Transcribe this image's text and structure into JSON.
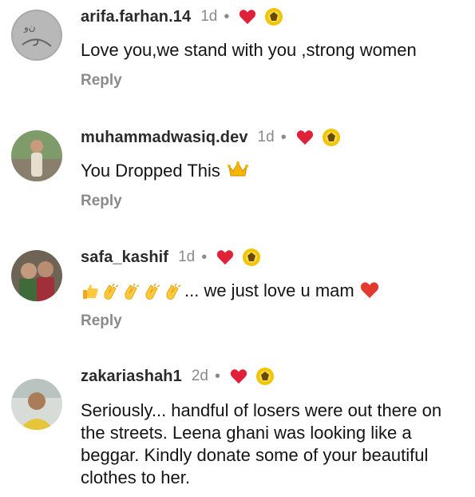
{
  "comments": [
    {
      "username": "arifa.farhan.14",
      "time": "1d",
      "dot": "•",
      "text": "Love you,we stand with you ,strong women",
      "reply": "Reply",
      "avatar_bg": "#9a9a9a"
    },
    {
      "username": "muhammadwasiq.dev",
      "time": "1d",
      "dot": "•",
      "text": "You Dropped This",
      "reply": "Reply",
      "avatar_bg": "#6f8a5c"
    },
    {
      "username": "safa_kashif",
      "time": "1d",
      "dot": "•",
      "text": "... we just love u mam",
      "reply": "Reply",
      "avatar_bg": "#7a6f60"
    },
    {
      "username": "zakariashah1",
      "time": "2d",
      "dot": "•",
      "text": "Seriously... handful of losers were out there on the streets. Leena ghani was looking like a beggar. Kindly donate some of your beautiful clothes to her.",
      "avatar_bg": "#cfd6d0"
    }
  ],
  "icons": {
    "heart": "heart-icon",
    "badge": "creator-badge-icon",
    "crown": "crown-emoji",
    "thumbs": "thumbs-up-emoji",
    "clap": "clapping-hands-emoji",
    "red_heart": "red-heart-emoji"
  },
  "colors": {
    "heart": "#e0213a",
    "muted": "#8a8a8a",
    "badge_yellow": "#f3c400"
  }
}
